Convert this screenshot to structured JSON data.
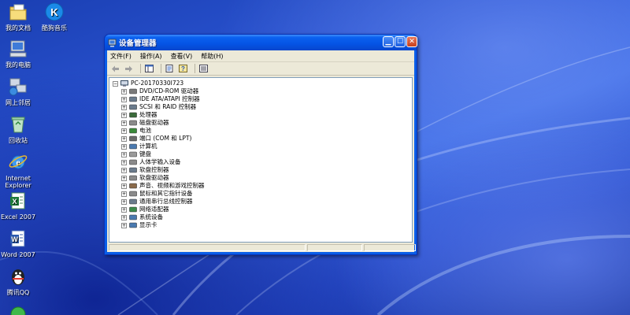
{
  "desktop_icons": [
    {
      "label": "我的文档",
      "icon": "my-documents-icon"
    },
    {
      "label": "酷狗音乐",
      "icon": "kugou-music-icon"
    },
    {
      "label": "我的电脑",
      "icon": "my-computer-icon"
    },
    {
      "label": "网上邻居",
      "icon": "network-places-icon"
    },
    {
      "label": "回收站",
      "icon": "recycle-bin-icon"
    },
    {
      "label": "Internet Explorer",
      "label_line1": "Internet",
      "label_line2": "Explorer",
      "icon": "internet-explorer-icon"
    },
    {
      "label": "Excel 2007",
      "icon": "excel-icon"
    },
    {
      "label": "Word 2007",
      "icon": "word-icon"
    },
    {
      "label": "腾讯QQ",
      "icon": "qq-icon"
    }
  ],
  "window": {
    "title": "设备管理器",
    "menu": [
      "文件(F)",
      "操作(A)",
      "查看(V)",
      "帮助(H)"
    ],
    "toolbar_icons": [
      "back-arrow-icon",
      "forward-arrow-icon",
      "show-hide-tree-icon",
      "properties-icon",
      "help-icon",
      "details-icon"
    ],
    "tree": {
      "root": "PC-20170330I723",
      "items": [
        {
          "label": "DVD/CD-ROM 驱动器",
          "icon": "dvd-drive-icon",
          "color": "#7a7a7a"
        },
        {
          "label": "IDE ATA/ATAPI 控制器",
          "icon": "ide-controller-icon",
          "color": "#6a7b8c"
        },
        {
          "label": "SCSI 和 RAID 控制器",
          "icon": "scsi-controller-icon",
          "color": "#6a7b8c"
        },
        {
          "label": "处理器",
          "icon": "processor-icon",
          "color": "#3a6a3a"
        },
        {
          "label": "磁盘驱动器",
          "icon": "disk-drive-icon",
          "color": "#8a8a8a"
        },
        {
          "label": "电池",
          "icon": "battery-icon",
          "color": "#3a8a3a"
        },
        {
          "label": "端口 (COM 和 LPT)",
          "icon": "port-icon",
          "color": "#6a6a6a"
        },
        {
          "label": "计算机",
          "icon": "computer-icon",
          "color": "#4a7ab0"
        },
        {
          "label": "键盘",
          "icon": "keyboard-icon",
          "color": "#9a9a9a"
        },
        {
          "label": "人体学输入设备",
          "icon": "hid-icon",
          "color": "#8a8a8a"
        },
        {
          "label": "软盘控制器",
          "icon": "floppy-controller-icon",
          "color": "#6a7b8c"
        },
        {
          "label": "软盘驱动器",
          "icon": "floppy-drive-icon",
          "color": "#8a8a8a"
        },
        {
          "label": "声音、视频和游戏控制器",
          "icon": "sound-icon",
          "color": "#8a6a4a"
        },
        {
          "label": "鼠标和其它指针设备",
          "icon": "mouse-icon",
          "color": "#8a8a8a"
        },
        {
          "label": "通用串行总线控制器",
          "icon": "usb-icon",
          "color": "#6a7b8c"
        },
        {
          "label": "网络适配器",
          "icon": "network-adapter-icon",
          "color": "#3a8a4a"
        },
        {
          "label": "系统设备",
          "icon": "system-device-icon",
          "color": "#4a7ab0"
        },
        {
          "label": "显示卡",
          "icon": "display-adapter-icon",
          "color": "#4a7ab0"
        }
      ]
    }
  },
  "colors": {
    "desktop_base": "#2d57d6",
    "titlebar": "#0553e4",
    "window_face": "#ece9d8",
    "tree_bg": "#ffffff"
  }
}
